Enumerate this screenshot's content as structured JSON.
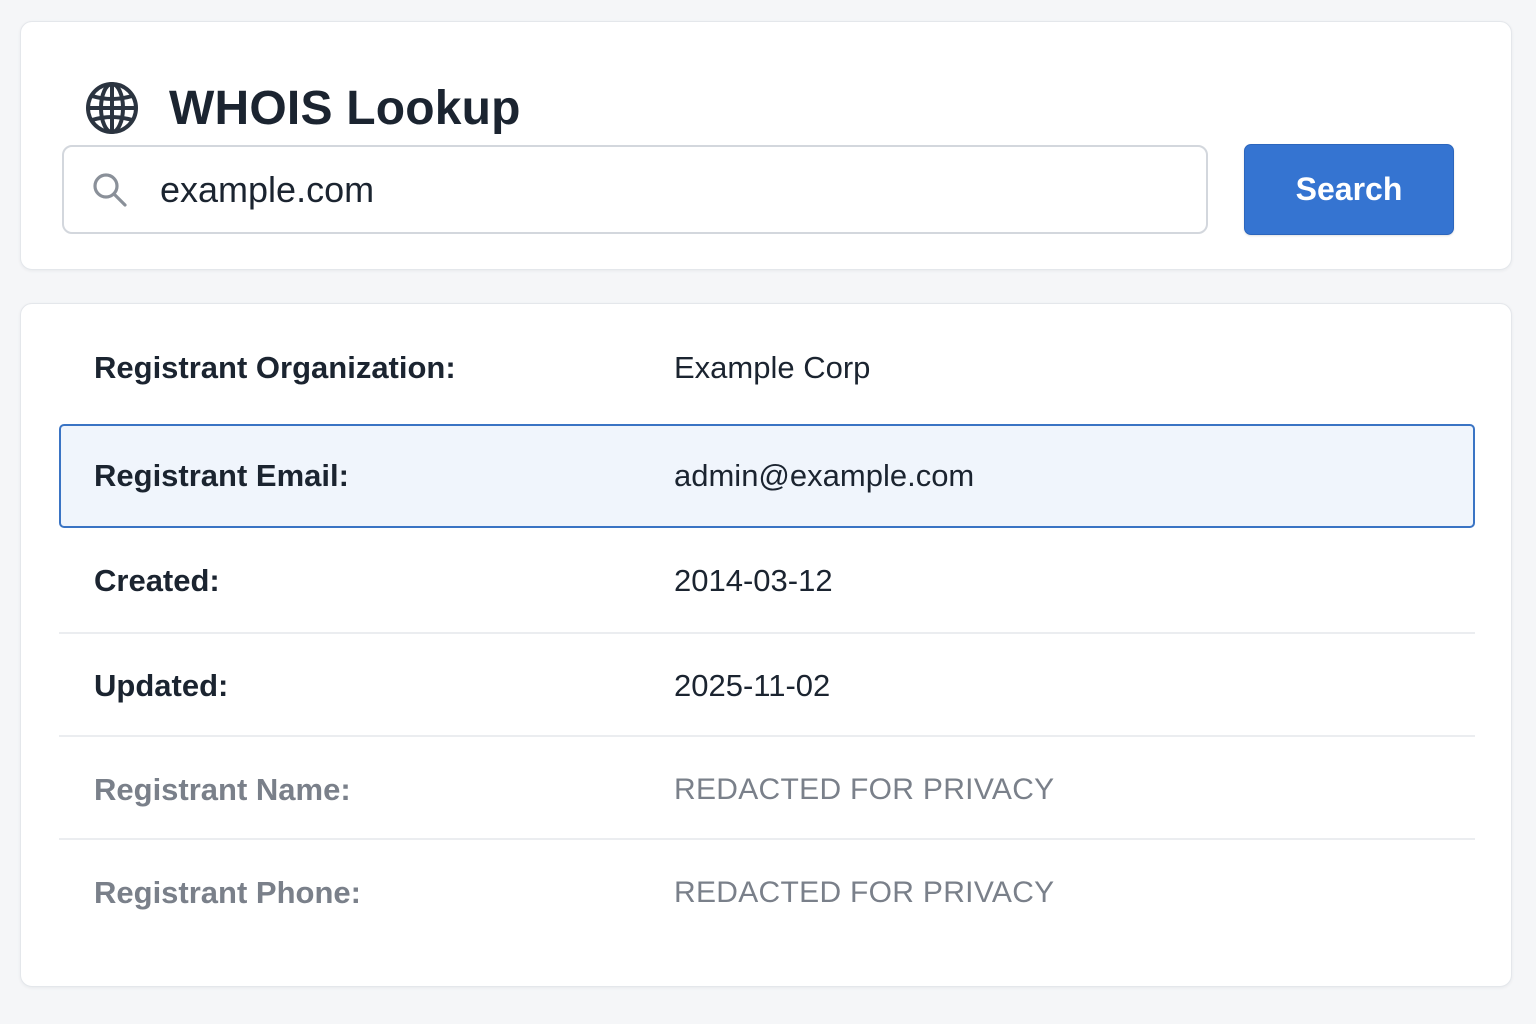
{
  "header": {
    "title": "WHOIS Lookup",
    "icon": "globe-icon"
  },
  "search": {
    "value": "example.com",
    "icon": "search-icon",
    "button_label": "Search"
  },
  "colors": {
    "accent": "#3574d1",
    "highlight_border": "#3a74c4",
    "highlight_bg": "#f0f5fc",
    "muted_text": "#7a808a"
  },
  "results": {
    "rows": [
      {
        "label": "Registrant Organization:",
        "value": "Example Corp"
      },
      {
        "label": "Registrant Email:",
        "value": "admin@example.com"
      },
      {
        "label": "Created:",
        "value": "2014-03-12"
      },
      {
        "label": "Updated:",
        "value": "2025-11-02"
      },
      {
        "label": "Registrant Name:",
        "value": "REDACTED FOR PRIVACY"
      },
      {
        "label": "Registrant Phone:",
        "value": "REDACTED FOR PRIVACY"
      }
    ]
  }
}
